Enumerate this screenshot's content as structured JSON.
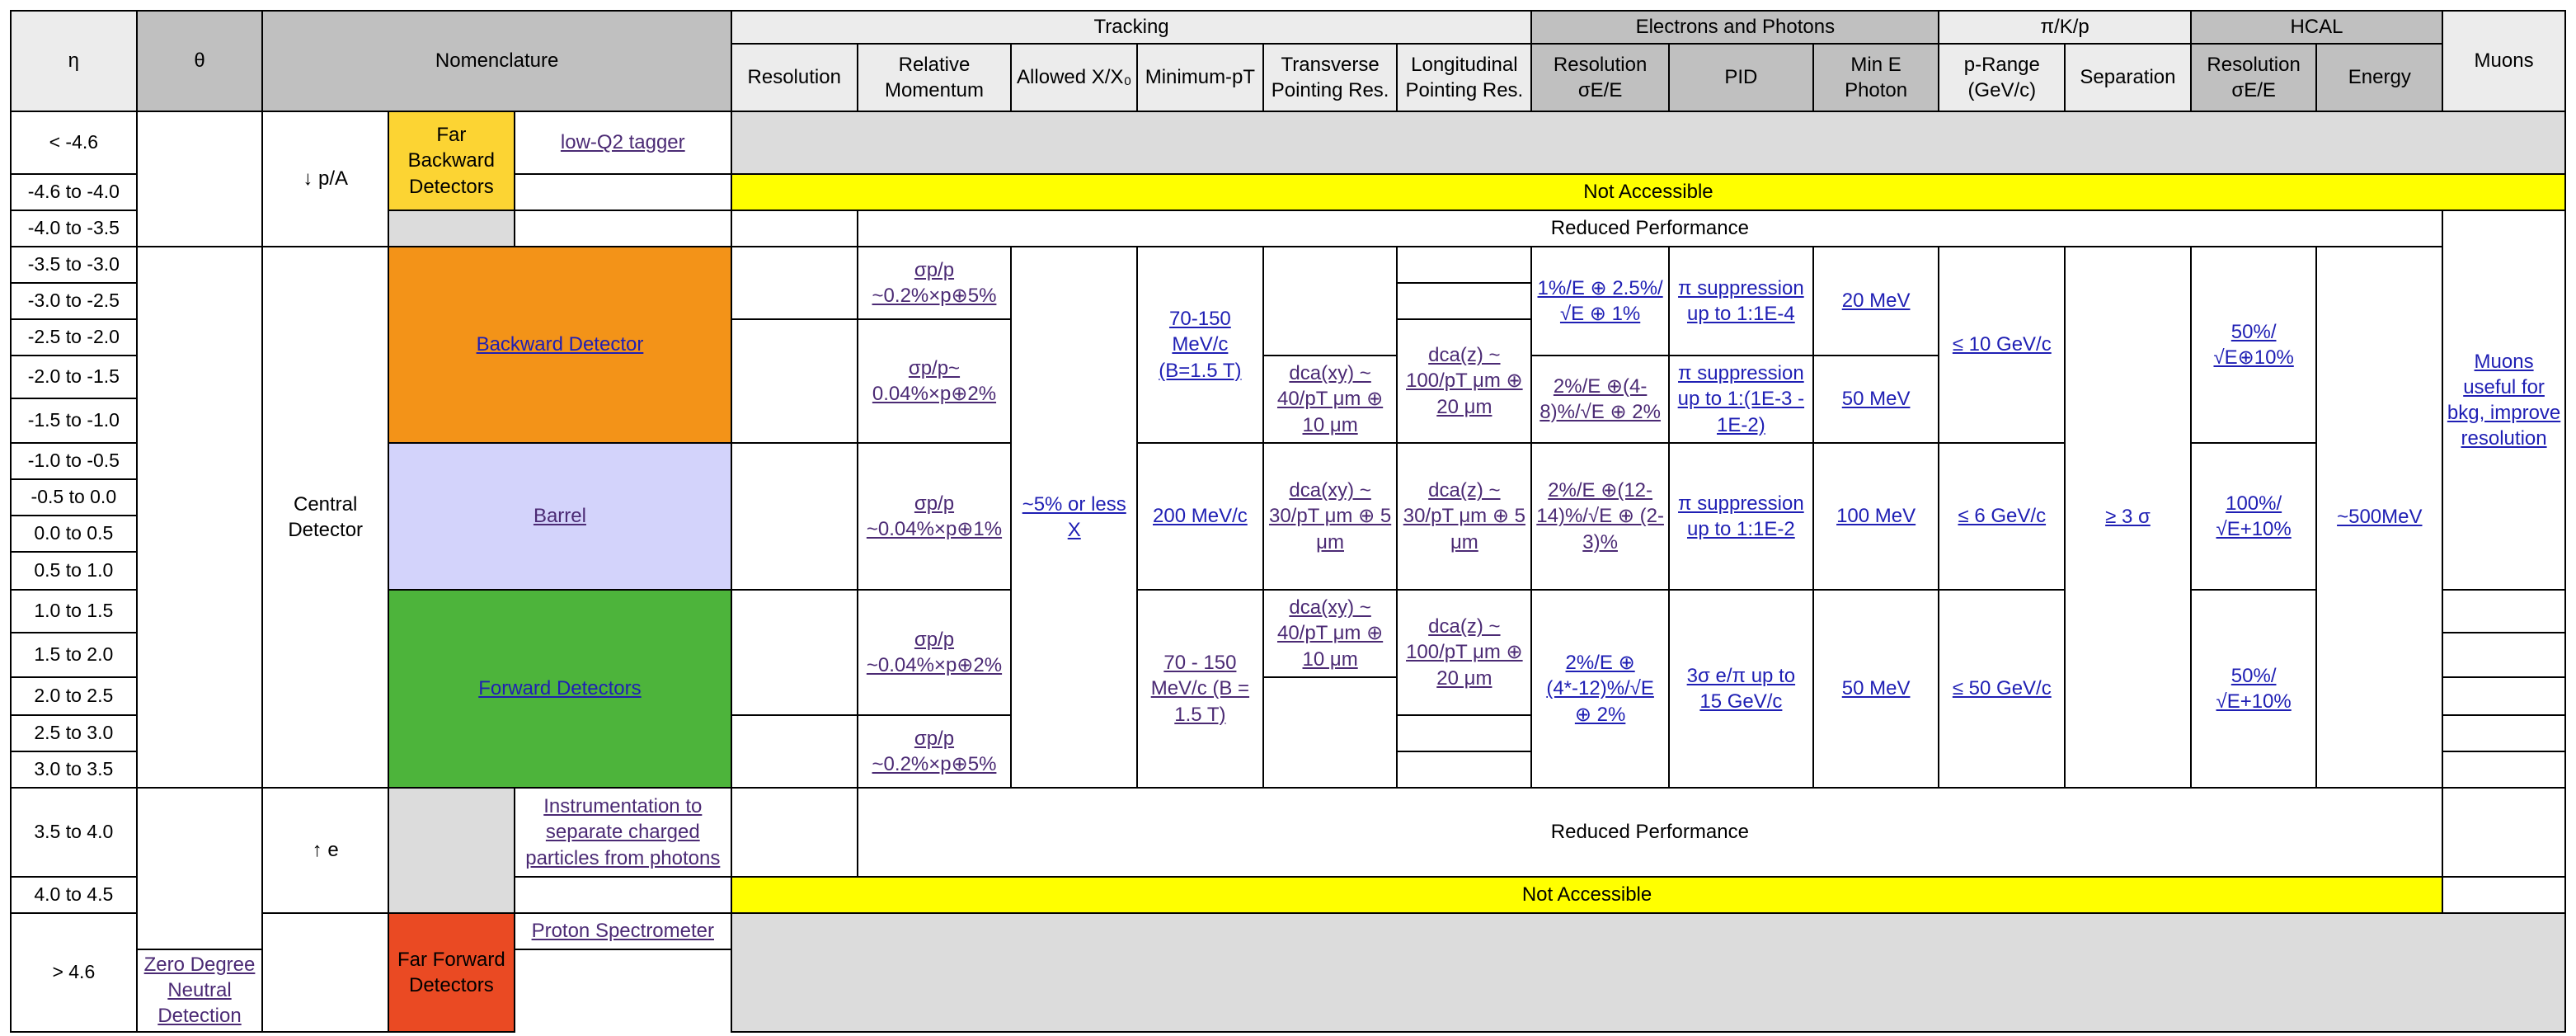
{
  "colors": {
    "header_dark": "#c0c0c0",
    "header_light": "#ececec",
    "not_accessible": "#ffff00",
    "unused_region": "#dcdcdc",
    "backward_detector": "#f39318",
    "barrel": "#d3d3fb",
    "forward_detectors": "#4db43b",
    "far_backward": "#fcd433",
    "far_forward": "#ea4a23",
    "link": "#1f1fb4",
    "visited_link": "#4b2a74"
  },
  "headers": {
    "eta": "η",
    "theta": "θ",
    "nomenclature": "Nomenclature",
    "tracking": "Tracking",
    "electrons_photons": "Electrons and Photons",
    "pid": "π/K/p",
    "hcal": "HCAL",
    "muons": "Muons",
    "sub": {
      "resolution": "Resolution",
      "relative_momentum": "Relative Momentum",
      "allowed_x": "Allowed X/X₀",
      "minimum_pt": "Minimum-pT",
      "transverse": "Transverse Pointing Res.",
      "longitudinal": "Longitudinal Pointing Res.",
      "em_resolution": "Resolution σE/E",
      "pid": "PID",
      "min_e_photon": "Min E Photon",
      "p_range": "p-Range (GeV/c)",
      "separation": "Separation",
      "hcal_resolution": "Resolution σE/E",
      "energy": "Energy"
    }
  },
  "eta_rows": [
    "< -4.6",
    "-4.6 to -4.0",
    "-4.0 to -3.5",
    "-3.5 to -3.0",
    "-3.0 to -2.5",
    "-2.5 to -2.0",
    "-2.0 to -1.5",
    "-1.5 to -1.0",
    "-1.0 to -0.5",
    "-0.5 to 0.0",
    "0.0 to 0.5",
    "0.5 to 1.0",
    "1.0 to 1.5",
    "1.5 to 2.0",
    "2.0 to 2.5",
    "2.5 to 3.0",
    "3.0 to 3.5",
    "3.5 to 4.0",
    "4.0 to 4.5",
    "> 4.6"
  ],
  "theta": {
    "backward_label": "↓ p/A",
    "forward_label": "↑ e"
  },
  "nomenclature": {
    "far_backward": "Far Backward Detectors",
    "low_q2": "low-Q2 tagger",
    "central": "Central Detector",
    "backward": "Backward Detector",
    "barrel": "Barrel",
    "forward": "Forward Detectors",
    "instrumentation": "Instrumentation to separate charged particles from photons",
    "far_forward": "Far Forward Detectors",
    "proton_spectrometer": "Proton Spectrometer",
    "zdc": "Zero Degree Neutral Detection"
  },
  "banners": {
    "not_accessible": "Not Accessible",
    "reduced_performance": "Reduced Performance"
  },
  "tracking": {
    "relmom_back_outer": "σp/p ~0.2%×p⊕5%",
    "relmom_back_inner": "σp/p~ 0.04%×p⊕2%",
    "relmom_barrel": "σp/p ~0.04%×p⊕1%",
    "relmom_fwd_inner": "σp/p ~0.04%×p⊕2%",
    "relmom_fwd_outer": "σp/p ~0.2%×p⊕5%",
    "allowed_x": "~5% or less X",
    "minpt_back": "70-150 MeV/c (B=1.5 T)",
    "minpt_barrel": "200 MeV/c",
    "minpt_fwd": "70 - 150 MeV/c (B = 1.5 T)",
    "trans_back": "dca(xy) ~ 40/pT μm ⊕ 10 μm",
    "trans_barrel": "dca(xy) ~ 30/pT μm ⊕ 5 μm",
    "trans_fwd": "dca(xy) ~ 40/pT μm ⊕ 10 μm",
    "long_back": "dca(z) ~ 100/pT μm ⊕ 20 μm",
    "long_barrel": "dca(z) ~ 30/pT μm ⊕ 5 μm",
    "long_fwd": "dca(z) ~ 100/pT μm ⊕ 20 μm"
  },
  "em": {
    "res_back_outer": "1%/E ⊕ 2.5%/√E ⊕ 1%",
    "res_back_inner": "2%/E ⊕(4-8)%/√E ⊕ 2%",
    "res_barrel": "2%/E ⊕(12-14)%/√E ⊕ (2-3)%",
    "res_fwd": "2%/E ⊕ (4*-12)%/√E ⊕ 2%",
    "pid_back_outer": "π suppression up to 1:1E-4",
    "pid_back_inner": "π suppression up to 1:(1E-3 - 1E-2)",
    "pid_barrel": "π suppression up to 1:1E-2",
    "pid_fwd": "3σ e/π up to 15 GeV/c",
    "mine_back_outer": "20 MeV",
    "mine_back_inner": "50 MeV",
    "mine_barrel": "100 MeV",
    "mine_fwd": "50 MeV"
  },
  "hadron_pid": {
    "prange_back": "≤ 10 GeV/c",
    "prange_barrel": "≤ 6 GeV/c",
    "prange_fwd": "≤ 50 GeV/c",
    "separation": "≥ 3 σ"
  },
  "hcal": {
    "res_back": "50%/ √E⊕10%",
    "res_barrel": "100%/ √E+10%",
    "res_fwd": "50%/ √E+10%",
    "energy": "~500MeV"
  },
  "muons": {
    "note": "Muons useful for bkg, improve resolution"
  }
}
